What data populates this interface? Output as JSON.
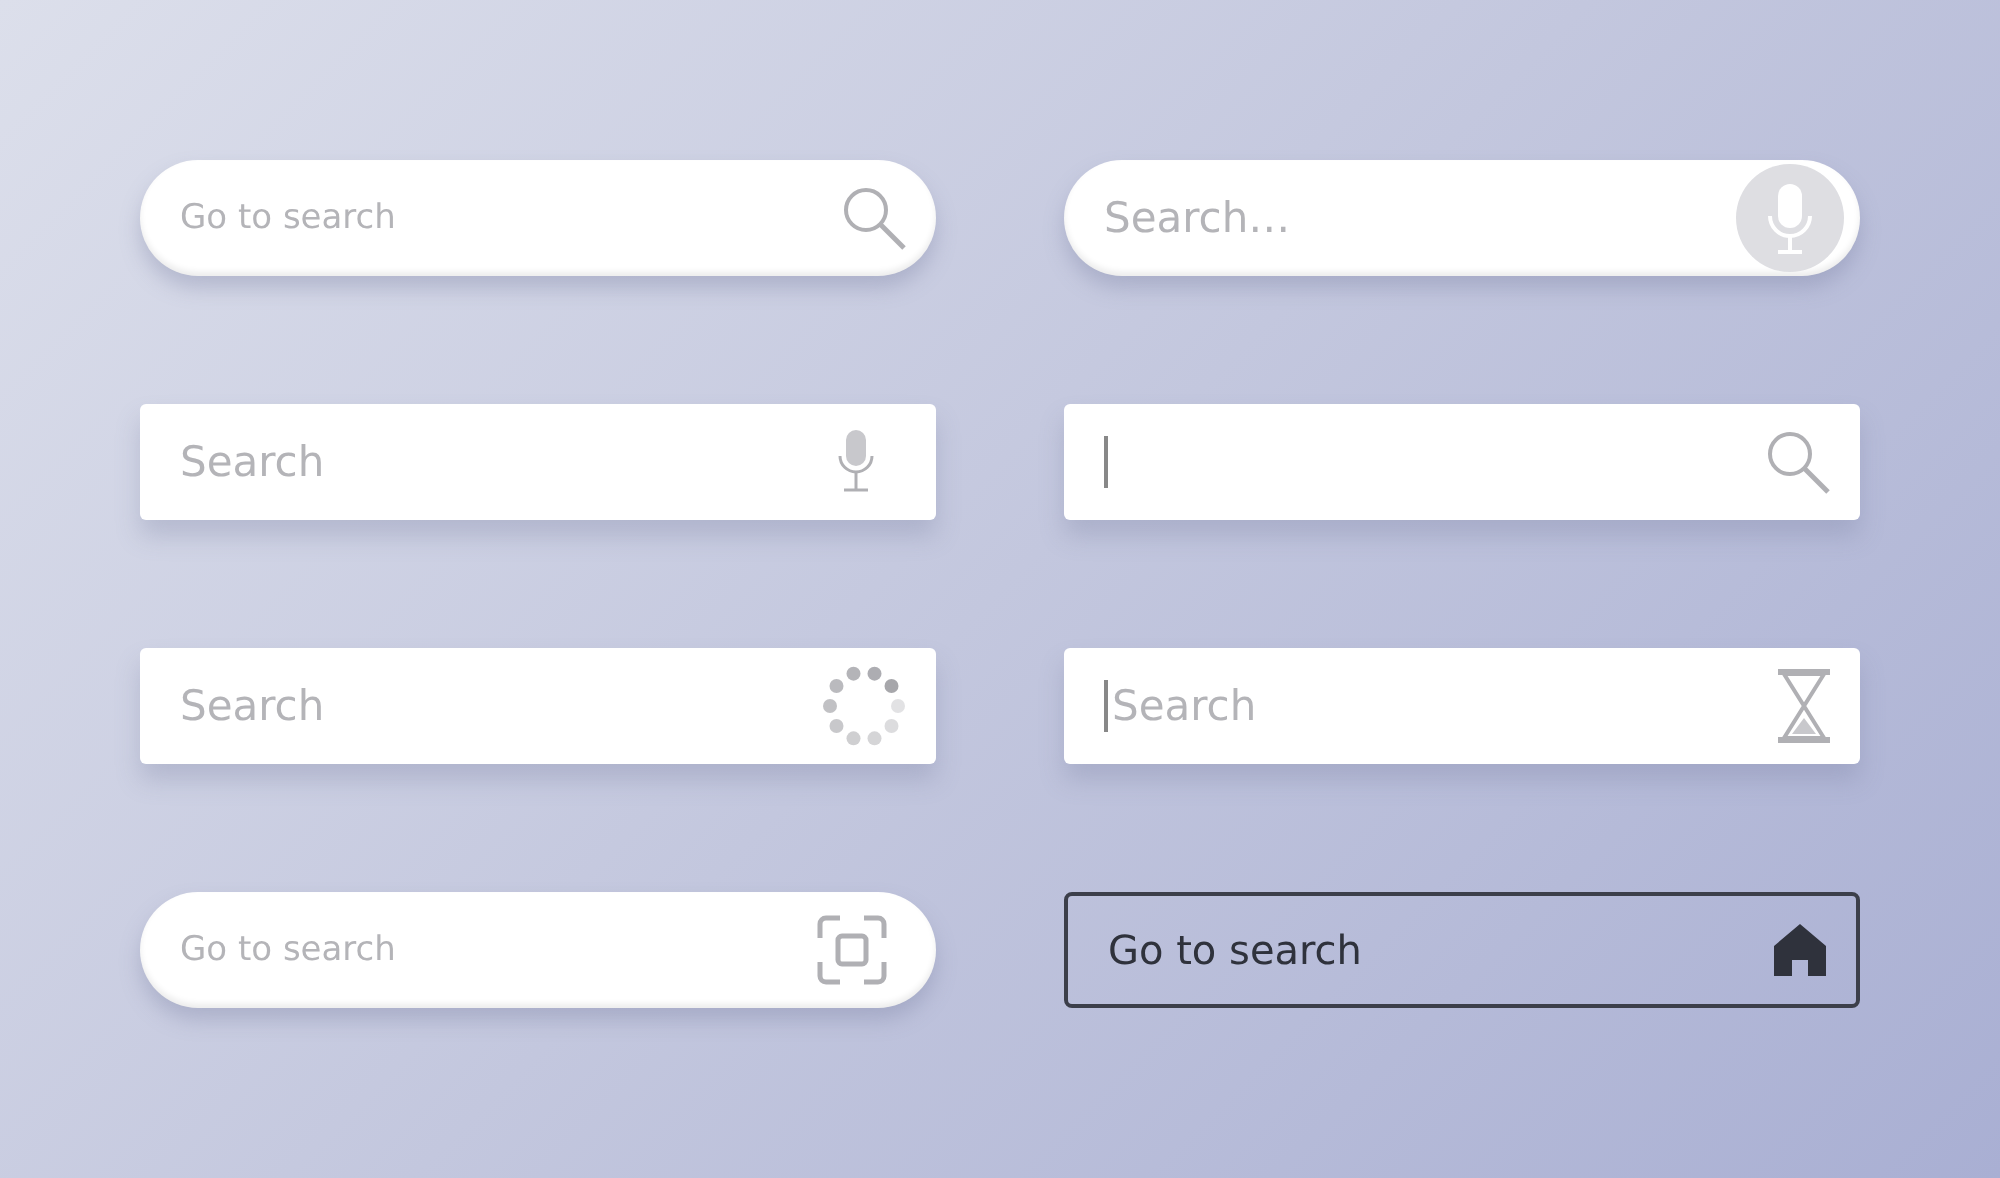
{
  "search_bars": [
    {
      "kind": "pillsearch",
      "placeholder": "Go to search",
      "cursor": false
    },
    {
      "kind": "pillmic",
      "placeholder": "Search…",
      "cursor": false
    },
    {
      "kind": "mic",
      "placeholder": "Search",
      "cursor": false
    },
    {
      "kind": "search",
      "cursor": true
    },
    {
      "kind": "loading",
      "placeholder": "Search",
      "cursor": false
    },
    {
      "kind": "hourglass",
      "placeholder": "Search",
      "cursor": true
    },
    {
      "kind": "pillscan",
      "placeholder": "Go to search",
      "cursor": false
    },
    {
      "kind": "outlined",
      "placeholder": "Go to search",
      "cursor": false
    }
  ]
}
